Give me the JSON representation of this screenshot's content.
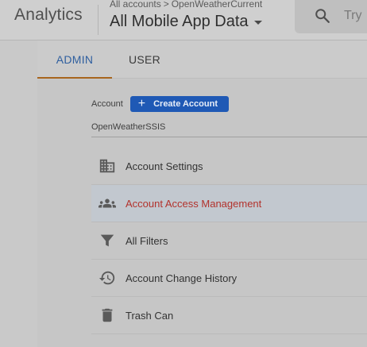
{
  "header": {
    "product_name": "Analytics",
    "breadcrumb": {
      "root": "All accounts",
      "separator": ">",
      "account": "OpenWeatherCurrent"
    },
    "view_title": "All Mobile App Data",
    "search_placeholder": "Try"
  },
  "tabs": [
    {
      "label": "ADMIN",
      "active": true
    },
    {
      "label": "USER",
      "active": false
    }
  ],
  "account_section": {
    "label": "Account",
    "create_button": {
      "icon": "plus-icon",
      "label": "Create Account"
    },
    "selected_account": "OpenWeatherSSIS"
  },
  "menu": [
    {
      "label": "Account Settings",
      "icon": "building-icon",
      "active": false
    },
    {
      "label": "Account Access Management",
      "icon": "people-icon",
      "active": true
    },
    {
      "label": "All Filters",
      "icon": "filter-icon",
      "active": false
    },
    {
      "label": "Account Change History",
      "icon": "history-icon",
      "active": false
    },
    {
      "label": "Trash Can",
      "icon": "trash-icon",
      "active": false
    }
  ],
  "colors": {
    "accent_blue": "#1f59b5",
    "active_tab_text": "#2f5f9f",
    "active_tab_underline": "#a8651e",
    "active_item_text": "#b2322c"
  }
}
